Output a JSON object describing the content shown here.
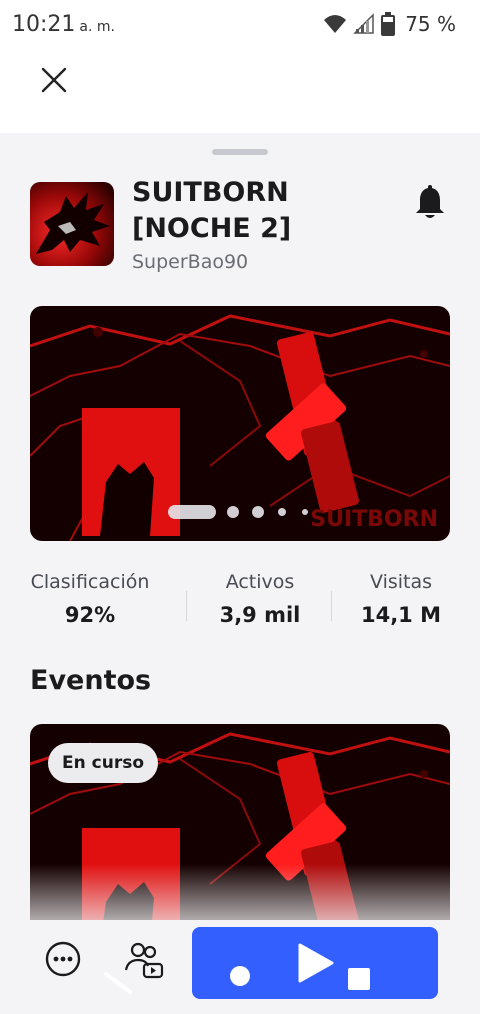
{
  "status_bar": {
    "time": "10:21",
    "ampm": "a. m.",
    "battery_percent": "75 %",
    "wifi_icon": "wifi-icon",
    "signal_icon": "cell-signal-icon",
    "battery_icon": "battery-icon"
  },
  "header": {
    "close_icon": "close-icon"
  },
  "game": {
    "title": "SUITBORN [NOCHE 2]",
    "creator": "SuperBao90",
    "notify_icon": "bell-icon"
  },
  "carousel": {
    "slide_count": 5,
    "active_index": 0,
    "watermark": "SUITBORN"
  },
  "stats": [
    {
      "label": "Clasificación",
      "value": "92%"
    },
    {
      "label": "Activos",
      "value": "3,9 mil"
    },
    {
      "label": "Visitas",
      "value": "14,1 M"
    }
  ],
  "events": {
    "heading": "Eventos",
    "badge": "En curso"
  },
  "bottom_bar": {
    "more_icon": "more-options-icon",
    "party_icon": "party-icon",
    "play_icon": "play-icon"
  },
  "colors": {
    "accent": "#335fff",
    "sheet_bg": "#f4f4f6",
    "art_red": "#e01010"
  }
}
